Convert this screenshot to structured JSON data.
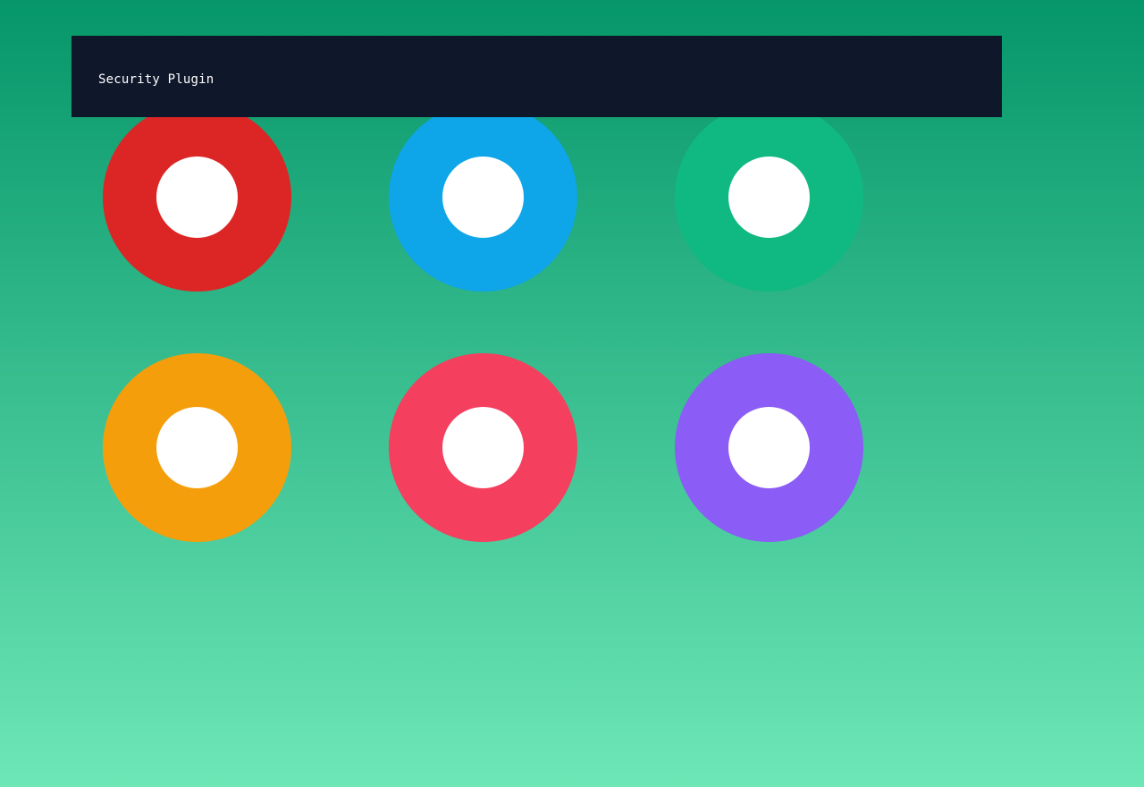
{
  "header": {
    "title": "Security Plugin"
  },
  "tiles": [
    {
      "color": "#dc2626"
    },
    {
      "color": "#0ea5e9"
    },
    {
      "color": "#10b981"
    },
    {
      "color": "#f59e0b"
    },
    {
      "color": "#f43f5e"
    },
    {
      "color": "#8b5cf6"
    }
  ],
  "colors": {
    "header_bg": "#0f172a",
    "gradient_top": "#059669",
    "gradient_bottom": "#6ee7b7",
    "hole": "#ffffff"
  }
}
